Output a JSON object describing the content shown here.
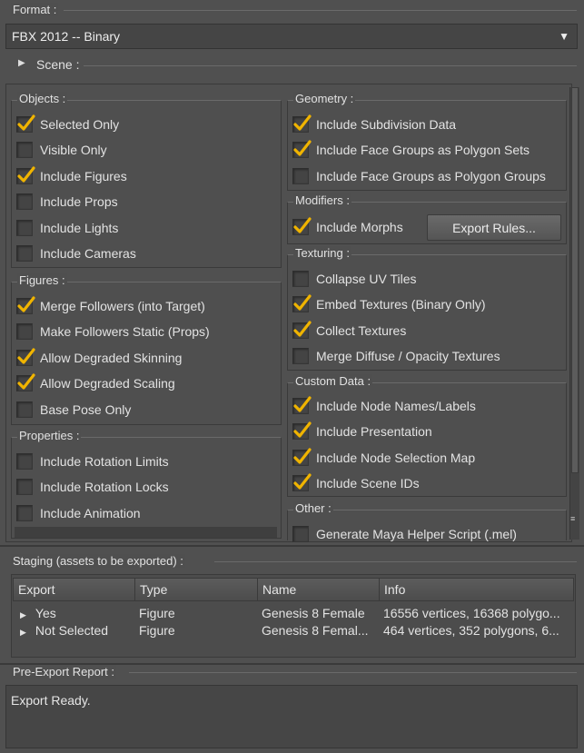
{
  "format": {
    "legend": "Format :",
    "value": "FBX 2012 -- Binary"
  },
  "scene": {
    "label": "Scene :"
  },
  "objects": {
    "legend": "Objects :",
    "items": [
      {
        "label": "Selected Only",
        "checked": true
      },
      {
        "label": "Visible Only",
        "checked": false
      },
      {
        "label": "Include Figures",
        "checked": true
      },
      {
        "label": "Include Props",
        "checked": false
      },
      {
        "label": "Include Lights",
        "checked": false
      },
      {
        "label": "Include Cameras",
        "checked": false
      }
    ]
  },
  "figures": {
    "legend": "Figures :",
    "items": [
      {
        "label": "Merge Followers (into Target)",
        "checked": true
      },
      {
        "label": "Make Followers Static (Props)",
        "checked": false
      },
      {
        "label": "Allow Degraded Skinning",
        "checked": true
      },
      {
        "label": "Allow Degraded Scaling",
        "checked": true
      },
      {
        "label": "Base Pose Only",
        "checked": false
      }
    ]
  },
  "properties": {
    "legend": "Properties :",
    "items": [
      {
        "label": "Include Rotation Limits",
        "checked": false
      },
      {
        "label": "Include Rotation Locks",
        "checked": false
      },
      {
        "label": "Include Animation",
        "checked": false
      }
    ]
  },
  "geometry": {
    "legend": "Geometry :",
    "items": [
      {
        "label": "Include Subdivision Data",
        "checked": true
      },
      {
        "label": "Include Face Groups as Polygon Sets",
        "checked": true
      },
      {
        "label": "Include Face Groups as Polygon Groups",
        "checked": false
      }
    ]
  },
  "modifiers": {
    "legend": "Modifiers :",
    "items": [
      {
        "label": "Include Morphs",
        "checked": true
      }
    ],
    "button": "Export Rules..."
  },
  "texturing": {
    "legend": "Texturing :",
    "items": [
      {
        "label": "Collapse UV Tiles",
        "checked": false
      },
      {
        "label": "Embed Textures (Binary Only)",
        "checked": true
      },
      {
        "label": "Collect Textures",
        "checked": true
      },
      {
        "label": "Merge Diffuse / Opacity Textures",
        "checked": false
      }
    ]
  },
  "custom_data": {
    "legend": "Custom Data :",
    "items": [
      {
        "label": "Include Node Names/Labels",
        "checked": true
      },
      {
        "label": "Include Presentation",
        "checked": true
      },
      {
        "label": "Include Node Selection Map",
        "checked": true
      },
      {
        "label": "Include Scene IDs",
        "checked": true
      }
    ]
  },
  "other": {
    "legend": "Other :",
    "items": [
      {
        "label": "Generate Maya Helper Script (.mel)",
        "checked": false
      }
    ]
  },
  "staging": {
    "legend": "Staging (assets to be exported) :",
    "columns": [
      "Export",
      "Type",
      "Name",
      "Info"
    ],
    "rows": [
      [
        "Yes",
        "Figure",
        "Genesis 8 Female",
        "16556 vertices, 16368 polygo..."
      ],
      [
        "Not Selected",
        "Figure",
        "Genesis 8 Femal...",
        "464 vertices, 352 polygons, 6..."
      ]
    ]
  },
  "report": {
    "legend": "Pre-Export Report :",
    "text": "Export Ready."
  },
  "colors": {
    "check": "#f0b400",
    "bg": "#505050"
  }
}
